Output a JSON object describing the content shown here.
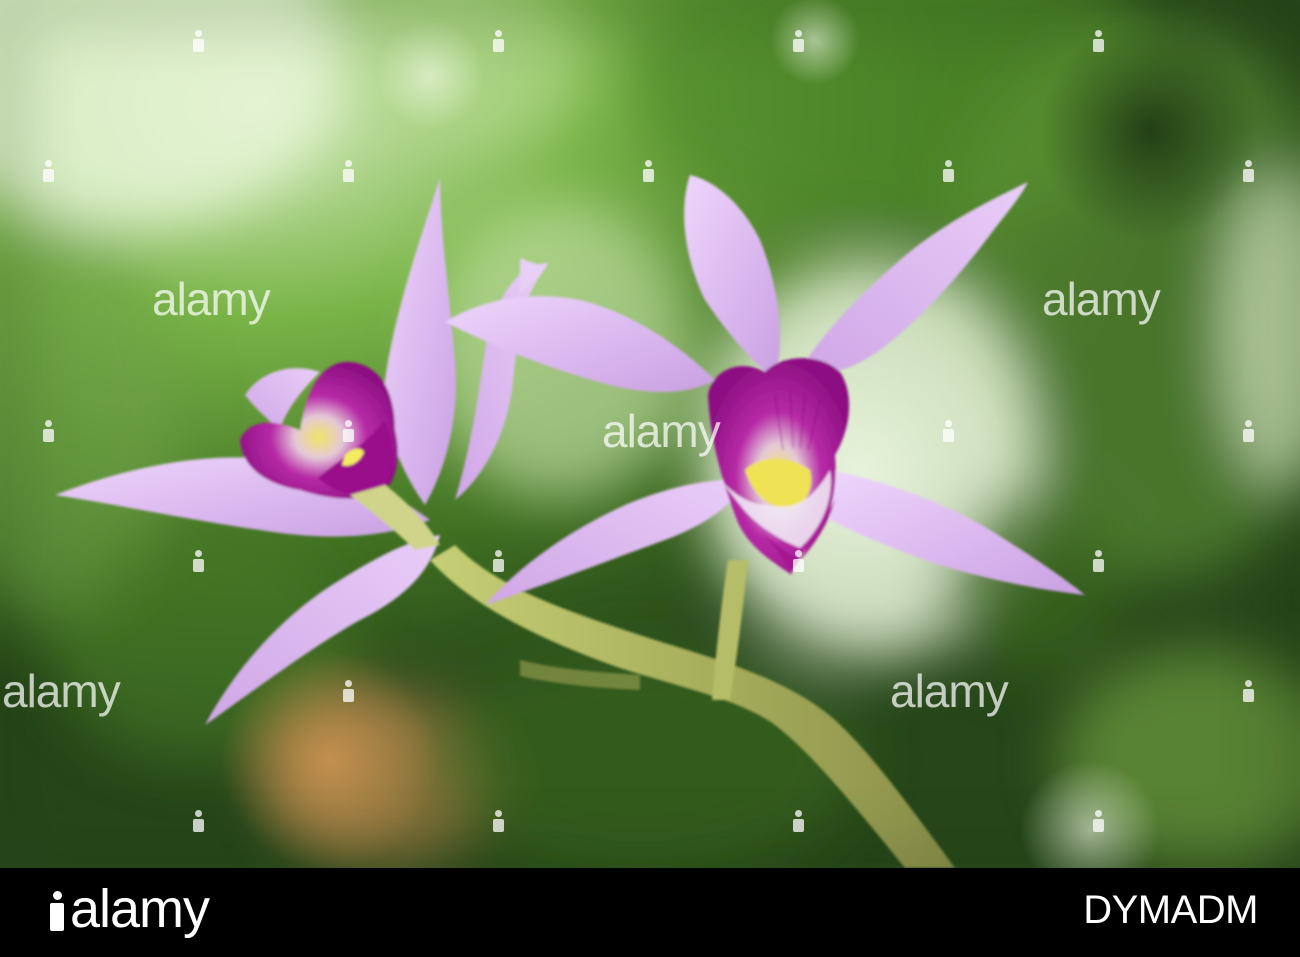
{
  "photo": {
    "subject": "two-pink-orchid-flowers-on-stem",
    "background_colors": [
      "#2f5a1a",
      "#6ea33c",
      "#a9d37d",
      "#e7f3dc"
    ],
    "petal_color": "#d9b7ef",
    "lip_color": "#a51598",
    "center_color": "#f3e646"
  },
  "watermark": {
    "text": "alamy"
  },
  "footer": {
    "logo_text": "alamy",
    "image_id": "DYMADM"
  }
}
